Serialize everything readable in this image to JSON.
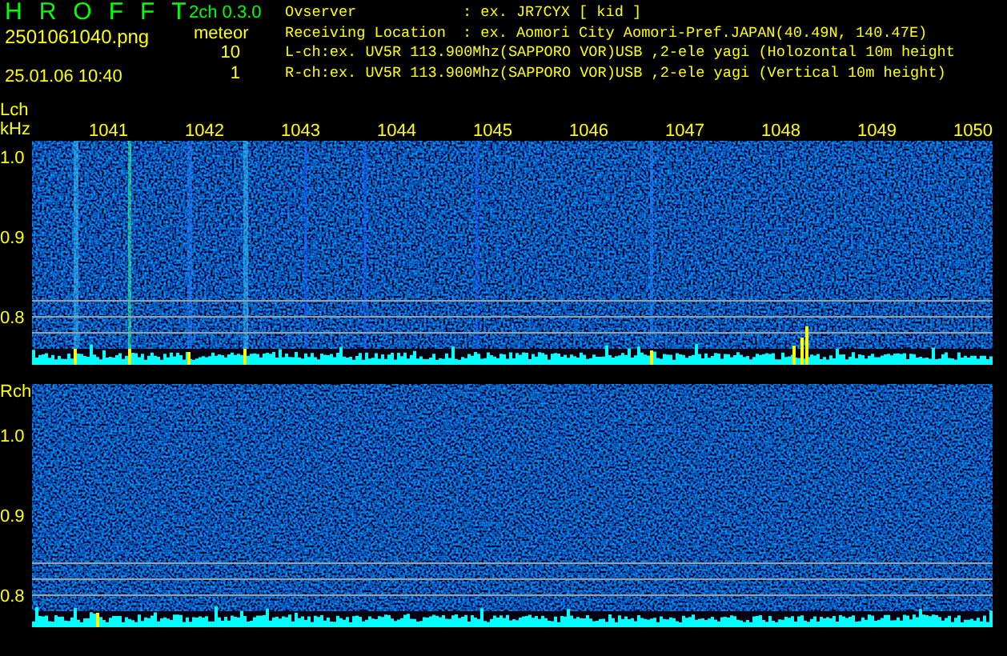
{
  "header": {
    "app_title": "HROFFT",
    "file_name": "2501061040.png",
    "date_time": "25.01.06 10:40",
    "version": "2ch 0.3.0",
    "mode": "meteor",
    "counts": [
      "10",
      "1"
    ],
    "info": [
      {
        "label": "Ovserver",
        "value": ": ex. JR7CYX [ kid ]"
      },
      {
        "label": "Receiving Location",
        "value": ": ex. Aomori City Aomori-Pref.JAPAN(40.49N, 140.47E)"
      },
      {
        "label": "L-ch:ex. UV5R 113.900Mhz(SAPPORO VOR)USB ,2-ele yagi (Holozontal 10m height"
      },
      {
        "label": "R-ch:ex. UV5R 113.900Mhz(SAPPORO VOR)USB ,2-ele yagi (Vertical 10m height)"
      }
    ]
  },
  "channels": [
    {
      "label": "Lch",
      "unit": "kHz",
      "time_labels": [
        "1041",
        "1042",
        "1043",
        "1044",
        "1045",
        "1046",
        "1047",
        "1048",
        "1049",
        "1050"
      ],
      "freq_labels": [
        "1.0",
        "0.9",
        "0.8"
      ]
    },
    {
      "label": "Rch",
      "freq_labels": [
        "1.0",
        "0.9",
        "0.8"
      ]
    }
  ]
}
